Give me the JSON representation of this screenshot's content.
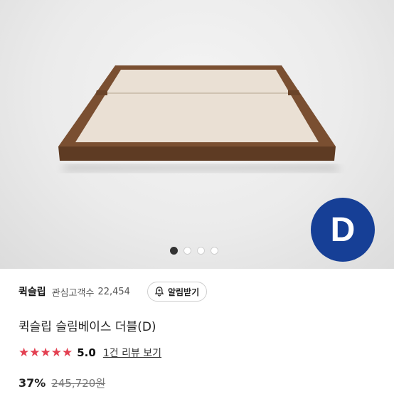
{
  "hero": {
    "badge_text": "D",
    "badge_color": "#163f96",
    "frame_color": "#7a4f31",
    "panel_color": "#eae0d4",
    "pagination": {
      "total": 4,
      "active_index": 0
    }
  },
  "seller": {
    "name": "퀵슬립",
    "fans_label": "관심고객수",
    "fans_count": "22,454",
    "alarm_label": "알림받기"
  },
  "product": {
    "title": "퀵슬립 슬림베이스 더블(D)",
    "rating": "5.0",
    "stars": 5,
    "star_color": "#e34152",
    "review_link": "1건 리뷰 보기",
    "discount": "37%",
    "original_price": "245,720원"
  }
}
